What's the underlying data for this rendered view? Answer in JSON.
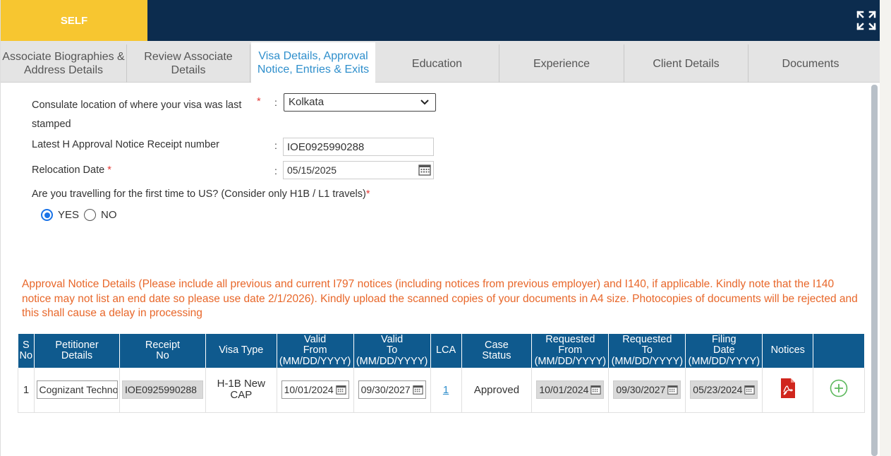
{
  "header": {
    "self_tab": "SELF"
  },
  "tabs": [
    {
      "label": "Associate Biographies & Address Details"
    },
    {
      "label": "Review Associate Details"
    },
    {
      "label": "Visa Details, Approval Notice, Entries & Exits"
    },
    {
      "label": "Education"
    },
    {
      "label": "Experience"
    },
    {
      "label": "Client Details"
    },
    {
      "label": "Documents"
    }
  ],
  "form": {
    "consulate_label": "Consulate location of where your visa was last stamped",
    "consulate_value": "Kolkata",
    "receipt_label": "Latest H Approval Notice Receipt number",
    "receipt_value": "IOE0925990288",
    "relocation_label": "Relocation Date",
    "relocation_value": "05/15/2025",
    "first_time_label": "Are you travelling for the first time to US? (Consider only H1B / L1 travels)",
    "required_mark": "*",
    "colon": ":",
    "yes_label": "YES",
    "no_label": "NO"
  },
  "notice_text": "Approval Notice Details (Please include all previous and current I797 notices (including notices from previous employer) and I140, if applicable. Kindly note that the I140 notice may not list an end date so please use date 2/1/2026). Kindly upload the scanned copies of your documents in A4 size. Photocopies of documents will be rejected and this shall cause a delay in processing",
  "table": {
    "headers": {
      "sno_1": "S",
      "sno_2": "No",
      "petitioner_1": "Petitioner",
      "petitioner_2": "Details",
      "receipt_1": "Receipt",
      "receipt_2": "No",
      "visa_type": "Visa Type",
      "valid_from_1": "Valid",
      "valid_from_2": "From",
      "valid_from_3": "(MM/DD/YYYY)",
      "valid_to_1": "Valid",
      "valid_to_2": "To",
      "valid_to_3": "(MM/DD/YYYY)",
      "lca": "LCA",
      "case_status_1": "Case",
      "case_status_2": "Status",
      "req_from_1": "Requested",
      "req_from_2": "From",
      "req_from_3": "(MM/DD/YYYY)",
      "req_to_1": "Requested",
      "req_to_2": "To",
      "req_to_3": "(MM/DD/YYYY)",
      "filing_1": "Filing",
      "filing_2": "Date",
      "filing_3": "(MM/DD/YYYY)",
      "notices": "Notices"
    },
    "rows": [
      {
        "sno": "1",
        "petitioner": "Cognizant Techno",
        "receipt": "IOE0925990288",
        "visa_type_1": "H-1B New",
        "visa_type_2": "CAP",
        "valid_from": "10/01/2024",
        "valid_to": "09/30/2027",
        "lca": "1",
        "case_status": "Approved",
        "requested_from": "10/01/2024",
        "requested_to": "09/30/2027",
        "filing_date": "05/23/2024"
      }
    ]
  }
}
